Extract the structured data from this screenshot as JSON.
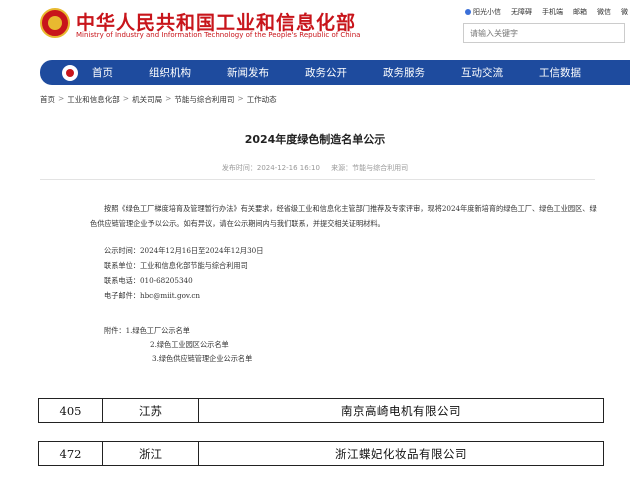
{
  "header": {
    "title": "中华人民共和国工业和信息化部",
    "subtitle": "Ministry of Industry and Information Technology of the People's Republic of China",
    "toplinks": [
      "阳光小信",
      "无障碍",
      "手机端",
      "邮箱",
      "微信",
      "微"
    ],
    "search_placeholder": "请输入关键字"
  },
  "nav": {
    "items": [
      "首页",
      "组织机构",
      "新闻发布",
      "政务公开",
      "政务服务",
      "互动交流",
      "工信数据"
    ]
  },
  "breadcrumb": [
    "首页",
    "工业和信息化部",
    "机关司局",
    "节能与综合利用司",
    "工作动态"
  ],
  "article": {
    "title": "2024年度绿色制造名单公示",
    "publish_time": "发布时间：2024-12-16 16:10",
    "source": "来源：节能与综合利用司",
    "paragraph": "按照《绿色工厂梯度培育及管理暂行办法》有关要求，经省级工业和信息化主管部门推荐及专家评审，现将2024年度新培育的绿色工厂、绿色工业园区、绿色供应链管理企业予以公示。如有异议，请在公示期间内与我们联系，并提交相关证明材料。",
    "info": [
      "公示时间：2024年12月16日至2024年12月30日",
      "联系单位：工业和信息化部节能与综合利用司",
      "联系电话：010-68205340",
      "电子邮件：hbc@miit.gov.cn"
    ],
    "attachments": [
      "附件：1.绿色工厂公示名单",
      "2.绿色工业园区公示名单",
      "3.绿色供应链管理企业公示名单"
    ]
  },
  "table": {
    "rows": [
      {
        "num": "405",
        "province": "江苏",
        "company": "南京高崎电机有限公司"
      },
      {
        "num": "472",
        "province": "浙江",
        "company": "浙江蝶妃化妆品有限公司"
      }
    ]
  },
  "colors": {
    "brand_red": "#c8151b",
    "nav_blue": "#1e4b9e"
  }
}
